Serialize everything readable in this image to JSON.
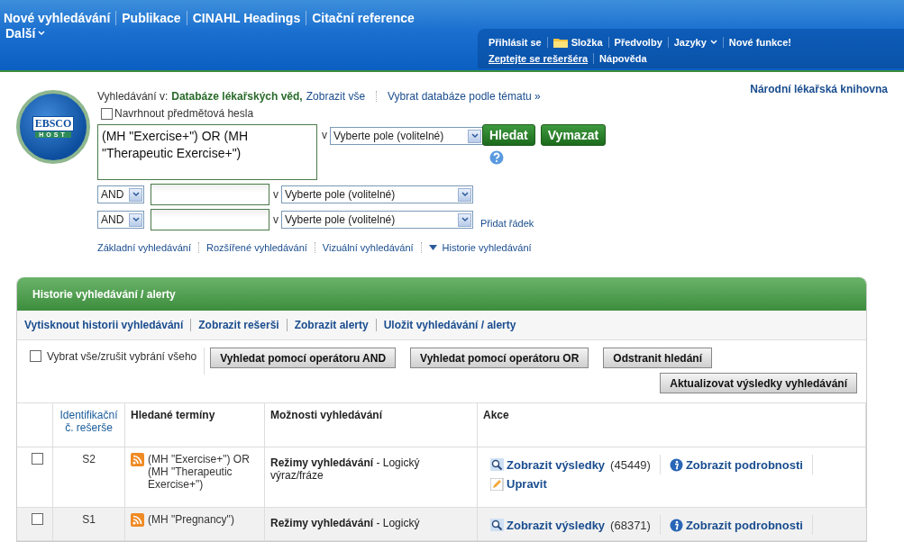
{
  "top_nav": {
    "links": [
      "Nové vyhledávání",
      "Publikace",
      "CINAHL Headings",
      "Citační reference"
    ],
    "more": "Další",
    "user_row_1": [
      {
        "label": "Přihlásit se",
        "kind": "link"
      },
      {
        "label": "Složka",
        "kind": "folder"
      },
      {
        "label": "Předvolby",
        "kind": "link"
      },
      {
        "label": "Jazyky",
        "kind": "menu"
      },
      {
        "label": "Nové funkce!",
        "kind": "link"
      }
    ],
    "user_row_2": [
      {
        "label": "Zeptejte se rešeršéra",
        "kind": "underlined"
      },
      {
        "label": "Nápověda",
        "kind": "link"
      }
    ]
  },
  "logo": {
    "top": "EBSCO",
    "bottom": "HOST"
  },
  "search": {
    "scope_label": "Vyhledávání v:",
    "database": "Databáze lékařských věd,",
    "show_all": "Zobrazit vše",
    "choose_by_topic": "Vybrat databáze podle tématu »",
    "library": "Národní lékařská knihovna",
    "suggest": {
      "label": "Navrhnout předmětová hesla",
      "checked": false
    },
    "query": "(MH \"Exercise+\") OR (MH \"Therapeutic Exercise+\")",
    "in": "v",
    "field": "Vyberte pole (volitelné)",
    "buttons": [
      "Hledat",
      "Vymazat"
    ],
    "rows": [
      {
        "operator": "AND",
        "in": "v",
        "field": "Vyberte pole (volitelné)"
      },
      {
        "operator": "AND",
        "in": "v",
        "field": "Vyberte pole (volitelné)",
        "add_row": "Přidat řádek"
      }
    ],
    "modes": [
      {
        "label": "Základní vyhledávání",
        "kind": "link"
      },
      {
        "label": "Rozšířené vyhledávání",
        "kind": "link"
      },
      {
        "label": "Vizuální vyhledávání",
        "kind": "link"
      },
      {
        "label": "Historie vyhledávání",
        "kind": "toggle"
      }
    ]
  },
  "history": {
    "title": "Historie vyhledávání / alerty",
    "links": [
      "Vytisknout historii vyhledávání",
      "Zobrazit rešerši",
      "Zobrazit alerty",
      "Uložit vyhledávání / alerty"
    ],
    "select_all": {
      "label": "Vybrat vše/zrušit vybrání všeho",
      "checked": false
    },
    "buttons": [
      "Vyhledat pomocí operátoru AND",
      "Vyhledat pomocí operátoru OR",
      "Odstranit hledání"
    ],
    "update_button": "Aktualizovat výsledky vyhledávání",
    "columns": [
      {
        "label": "Identifikační č. rešerše",
        "kind": "link"
      },
      {
        "label": "Hledané termíny",
        "kind": "plain"
      },
      {
        "label": "Možnosti vyhledávání",
        "kind": "plain"
      },
      {
        "label": "Akce",
        "kind": "plain"
      }
    ],
    "rows": [
      {
        "checked": false,
        "id": "S2",
        "terms": "(MH \"Exercise+\") OR (MH \"Therapeutic Exercise+\")",
        "options": "**Režimy vyhledávání** - Logický výraz/fráze",
        "show_results": "Zobrazit výsledky",
        "count": "(45449)",
        "details": "Zobrazit podrobnosti",
        "edit": "Upravit"
      },
      {
        "checked": false,
        "id": "S1",
        "terms": "(MH \"Pregnancy\")",
        "options": "**Režimy vyhledávání** - Logický",
        "show_results": "Zobrazit výsledky",
        "count": "(68371)",
        "details": "Zobrazit podrobnosti"
      }
    ]
  }
}
